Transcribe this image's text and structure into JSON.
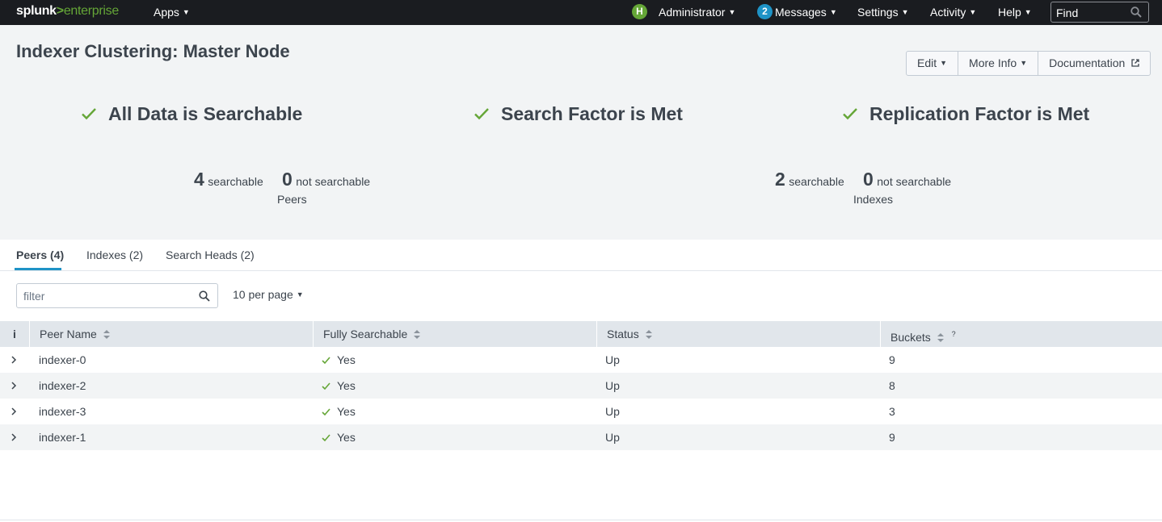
{
  "nav": {
    "logo_splunk": "splunk",
    "logo_gt": ">",
    "logo_enterprise": "enterprise",
    "apps": "Apps",
    "user_initial": "H",
    "user": "Administrator",
    "messages_count": "2",
    "messages": "Messages",
    "settings": "Settings",
    "activity": "Activity",
    "help": "Help",
    "find_placeholder": "Find"
  },
  "header": {
    "title": "Indexer Clustering: Master Node",
    "buttons": {
      "edit": "Edit",
      "more_info": "More Info",
      "documentation": "Documentation"
    }
  },
  "status": {
    "data_searchable": "All Data is Searchable",
    "search_factor": "Search Factor is Met",
    "replication_factor": "Replication Factor is Met"
  },
  "peers_summary": {
    "searchable_count": "4",
    "searchable_label": "searchable",
    "not_searchable_count": "0",
    "not_searchable_label": "not searchable",
    "label": "Peers"
  },
  "indexes_summary": {
    "searchable_count": "2",
    "searchable_label": "searchable",
    "not_searchable_count": "0",
    "not_searchable_label": "not searchable",
    "label": "Indexes"
  },
  "tabs": [
    {
      "label": "Peers (4)",
      "active": true
    },
    {
      "label": "Indexes (2)",
      "active": false
    },
    {
      "label": "Search Heads (2)",
      "active": false
    }
  ],
  "filter": {
    "placeholder": "filter",
    "per_page": "10 per page"
  },
  "table": {
    "info_header": "i",
    "columns": [
      "Peer Name",
      "Fully Searchable",
      "Status",
      "Buckets"
    ],
    "buckets_help": "?",
    "rows": [
      {
        "name": "indexer-0",
        "searchable": "Yes",
        "status": "Up",
        "buckets": "9"
      },
      {
        "name": "indexer-2",
        "searchable": "Yes",
        "status": "Up",
        "buckets": "8"
      },
      {
        "name": "indexer-3",
        "searchable": "Yes",
        "status": "Up",
        "buckets": "3"
      },
      {
        "name": "indexer-1",
        "searchable": "Yes",
        "status": "Up",
        "buckets": "9"
      }
    ]
  },
  "colors": {
    "nav_bg": "#1a1c20",
    "accent_green": "#65a637",
    "accent_blue": "#1e93c6",
    "panel_bg": "#f2f4f5",
    "header_bg": "#e1e6eb",
    "text": "#3c444d"
  }
}
